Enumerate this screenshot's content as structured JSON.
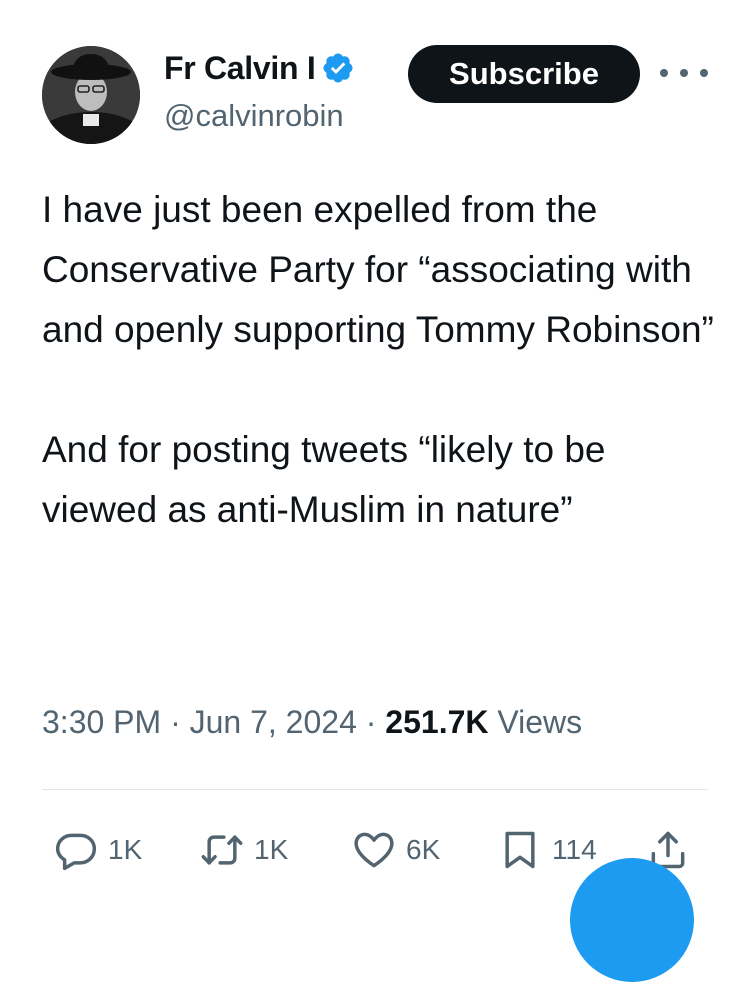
{
  "author": {
    "display_name": "Fr Calvin I",
    "handle": "@calvinrobin",
    "verified_icon": "verified-badge-icon"
  },
  "header": {
    "subscribe_label": "Subscribe",
    "more_icon": "more-icon"
  },
  "tweet": {
    "paragraphs": [
      "I have just been expelled from the Conservative Party for “associating with and openly supporting Tommy Robinson”",
      "And for posting tweets “likely to be viewed as anti-Muslim in nature”"
    ],
    "time": "3:30 PM",
    "date": "Jun 7, 2024",
    "separator": "·",
    "views_count": "251.7K",
    "views_label": "Views"
  },
  "actions": {
    "replies": "1K",
    "reposts": "1K",
    "likes": "6K",
    "bookmarks": "114"
  },
  "colors": {
    "accent": "#1d9bf0",
    "text": "#0f1419",
    "muted": "#536471"
  }
}
